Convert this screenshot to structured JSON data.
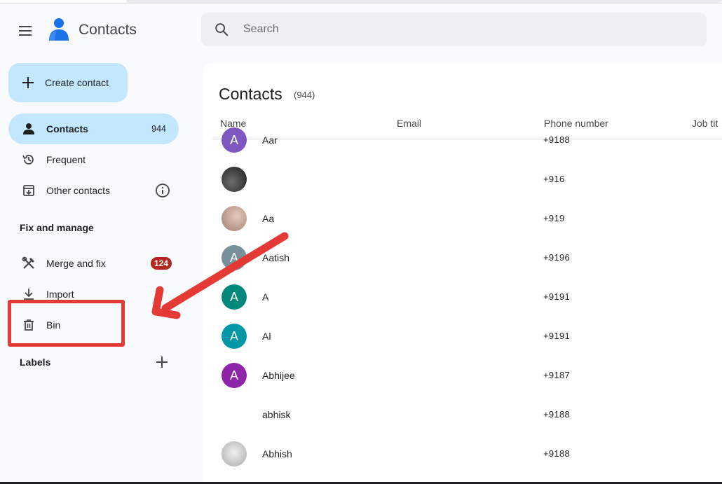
{
  "header": {
    "app_title": "Contacts",
    "search_placeholder": "Search"
  },
  "sidebar": {
    "create_label": "Create contact",
    "items": [
      {
        "label": "Contacts",
        "count": "944",
        "icon": "person-icon",
        "active": true
      },
      {
        "label": "Frequent",
        "icon": "history-icon"
      },
      {
        "label": "Other contacts",
        "icon": "archive-download-icon"
      }
    ],
    "fix_manage_title": "Fix and manage",
    "manage_items": [
      {
        "label": "Merge and fix",
        "badge": "124",
        "icon": "merge-tools-icon"
      },
      {
        "label": "Import",
        "icon": "download-icon"
      },
      {
        "label": "Bin",
        "icon": "trash-icon"
      }
    ],
    "labels_title": "Labels"
  },
  "main": {
    "title": "Contacts",
    "count": "(944)",
    "columns": [
      "Name",
      "Email",
      "Phone number",
      "Job tit"
    ],
    "rows": [
      {
        "initial": "A",
        "color": "#7e57c2",
        "name": "Aar",
        "phone": "+9188"
      },
      {
        "initial": "",
        "color": "#3c3c3c",
        "name": "",
        "phone": "+916"
      },
      {
        "initial": "",
        "color": "#c9a79a",
        "name": "Aa",
        "phone": "+919"
      },
      {
        "initial": "A",
        "color": "#78909c",
        "name": "Aatish",
        "phone": "+9196"
      },
      {
        "initial": "A",
        "color": "#00897b",
        "name": "A",
        "phone": "+9191"
      },
      {
        "initial": "A",
        "color": "#0097a7",
        "name": "Al",
        "phone": "+9191"
      },
      {
        "initial": "A",
        "color": "#8e24aa",
        "name": "Abhijee",
        "phone": "+9187"
      },
      {
        "initial": "",
        "color": "#ffffff",
        "name": "abhisk",
        "phone": "+9188"
      },
      {
        "initial": "",
        "color": "#d5d5d5",
        "name": "Abhish",
        "phone": "+9188"
      }
    ]
  },
  "colors": {
    "accent": "#c2e7ff",
    "annotation_red": "#e53935",
    "badge_red": "#b3261e"
  }
}
